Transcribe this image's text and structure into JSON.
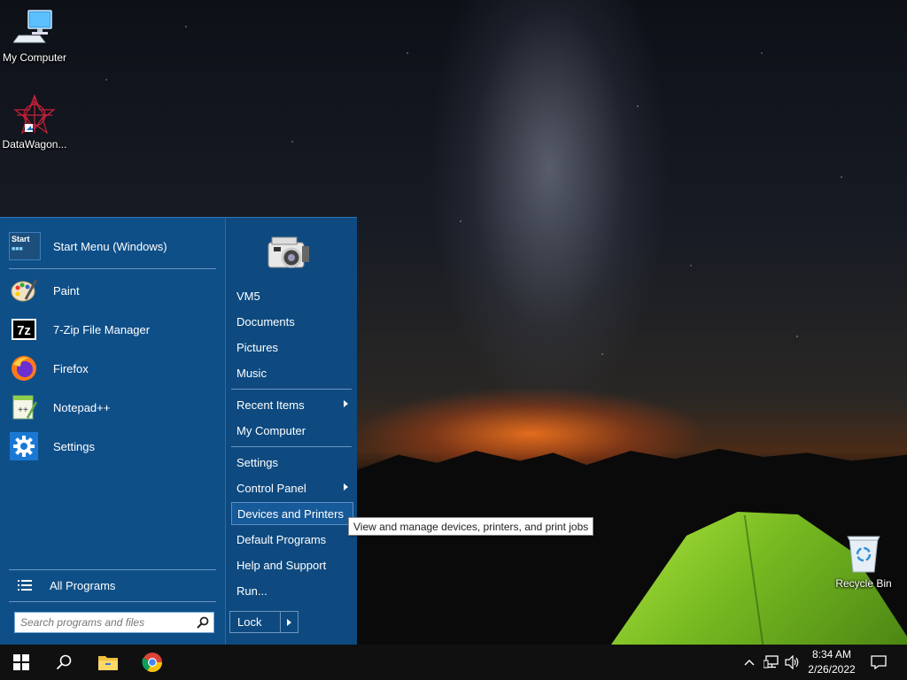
{
  "desktop": {
    "icons": [
      {
        "label": "My Computer",
        "icon": "my-computer-icon"
      },
      {
        "label": "DataWagon...",
        "icon": "datawagon-icon"
      },
      {
        "label": "Recycle Bin",
        "icon": "recycle-bin-icon"
      }
    ]
  },
  "start_menu": {
    "header_title": "Start Menu (Windows)",
    "apps": [
      {
        "label": "Paint",
        "icon": "paint-icon"
      },
      {
        "label": "7-Zip File Manager",
        "icon": "7zip-icon"
      },
      {
        "label": "Firefox",
        "icon": "firefox-icon"
      },
      {
        "label": "Notepad++",
        "icon": "notepadpp-icon"
      },
      {
        "label": "Settings",
        "icon": "settings-gear-icon"
      }
    ],
    "all_programs_label": "All Programs",
    "search_placeholder": "Search programs and files",
    "right_items": [
      {
        "label": "VM5"
      },
      {
        "label": "Documents"
      },
      {
        "label": "Pictures"
      },
      {
        "label": "Music"
      },
      {
        "label": "Recent Items",
        "submenu": true
      },
      {
        "label": "My Computer"
      },
      {
        "label": "Settings"
      },
      {
        "label": "Control Panel",
        "submenu": true
      },
      {
        "label": "Devices and Printers",
        "highlighted": true
      },
      {
        "label": "Default Programs"
      },
      {
        "label": "Help and Support"
      },
      {
        "label": "Run..."
      }
    ],
    "lock_label": "Lock",
    "tooltip": "View and manage devices, printers, and print jobs",
    "accent_color": "#0f4f88"
  },
  "taskbar": {
    "pinned": [
      "windows-start-icon",
      "search-icon",
      "file-explorer-icon",
      "chrome-icon"
    ],
    "tray": [
      "chevron-up-icon",
      "network-icon",
      "volume-icon"
    ],
    "time": "8:34 AM",
    "date": "2/26/2022"
  }
}
